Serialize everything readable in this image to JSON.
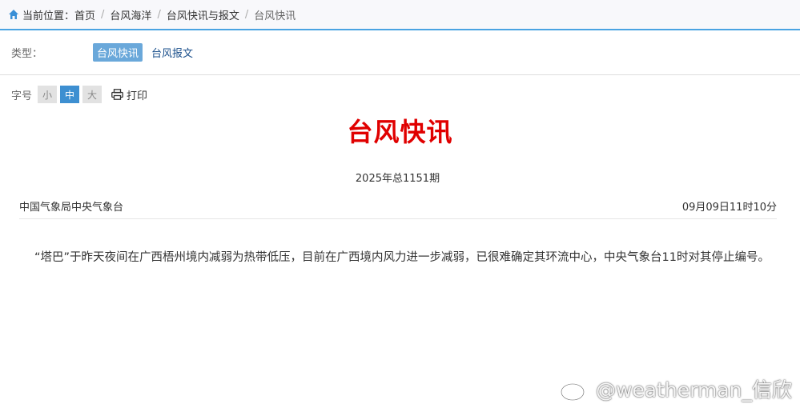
{
  "breadcrumb": {
    "prefix": "当前位置：",
    "items": [
      "首页",
      "台风海洋",
      "台风快讯与报文",
      "台风快讯"
    ]
  },
  "type_filter": {
    "label": "类型：",
    "tabs": [
      {
        "label": "台风快讯",
        "active": true
      },
      {
        "label": "台风报文",
        "active": false
      }
    ]
  },
  "font_size": {
    "label": "字号",
    "options": [
      {
        "label": "小",
        "active": false
      },
      {
        "label": "中",
        "active": true
      },
      {
        "label": "大",
        "active": false
      }
    ],
    "print_label": "打印"
  },
  "article": {
    "title": "台风快讯",
    "issue": "2025年总1151期",
    "publisher": "中国气象局中央气象台",
    "datetime": "09月09日11时10分",
    "body": "“塔巴”于昨天夜间在广西梧州境内减弱为热带低压，目前在广西境内风力进一步减弱，已很难确定其环流中心，中央气象台11时对其停止编号。"
  },
  "watermark": {
    "text": "@weatherman_信欣"
  },
  "colors": {
    "title_red": "#e00000",
    "accent_blue": "#4aa3e2",
    "active_tab": "#6aa8da",
    "active_size": "#3d8fd1"
  }
}
